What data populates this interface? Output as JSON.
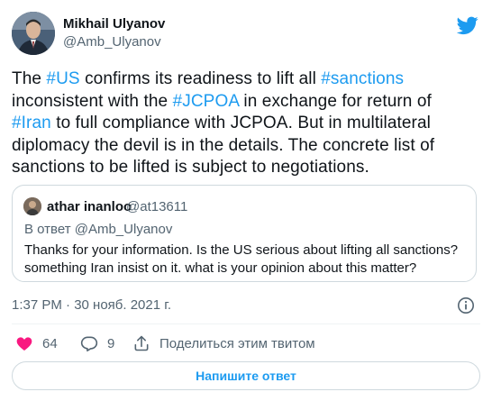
{
  "author": {
    "name": "Mikhail Ulyanov",
    "handle": "@Amb_Ulyanov"
  },
  "tweet": {
    "lines": [
      [
        {
          "text": "The ",
          "hashtag": false
        },
        {
          "text": "#US",
          "hashtag": true
        },
        {
          "text": " confirms its readiness to lift all ",
          "hashtag": false
        },
        {
          "text": "#sanctions",
          "hashtag": true
        }
      ],
      [
        {
          "text": "inconsistent with the ",
          "hashtag": false
        },
        {
          "text": "#JCPOA",
          "hashtag": true
        },
        {
          "text": " in exchange for return of",
          "hashtag": false
        }
      ],
      [
        {
          "text": "#Iran",
          "hashtag": true
        },
        {
          "text": " to full compliance with JCPOA. But in multilateral",
          "hashtag": false
        }
      ],
      [
        {
          "text": "diplomacy the devil is in the details. The concrete list of",
          "hashtag": false
        }
      ],
      [
        {
          "text": "sanctions to be lifted is subject to negotiations.",
          "hashtag": false
        }
      ]
    ]
  },
  "quote": {
    "name": "athar inanloo",
    "handle": "@at13611",
    "reply_to": "В ответ @Amb_Ulyanov",
    "lines": [
      "Thanks for your information. Is the US serious about lifting all sanctions?",
      "something Iran insist on it. what is your opinion about this matter?"
    ]
  },
  "meta": {
    "timestamp": "1:37 PM · 30 нояб. 2021 г."
  },
  "actions": {
    "likes": "64",
    "replies": "9",
    "share_label": "Поделиться этим твитом"
  },
  "reply_button": {
    "label": "Напишите ответ"
  },
  "colors": {
    "accent": "#1d9bf0",
    "like": "#f91880",
    "text": "#0f1419",
    "secondary": "#536471",
    "border": "#cfd9de"
  },
  "icons": {
    "brand": "twitter-bird-icon",
    "info": "info-icon",
    "like": "heart-icon",
    "reply": "comment-icon",
    "share": "share-icon"
  }
}
